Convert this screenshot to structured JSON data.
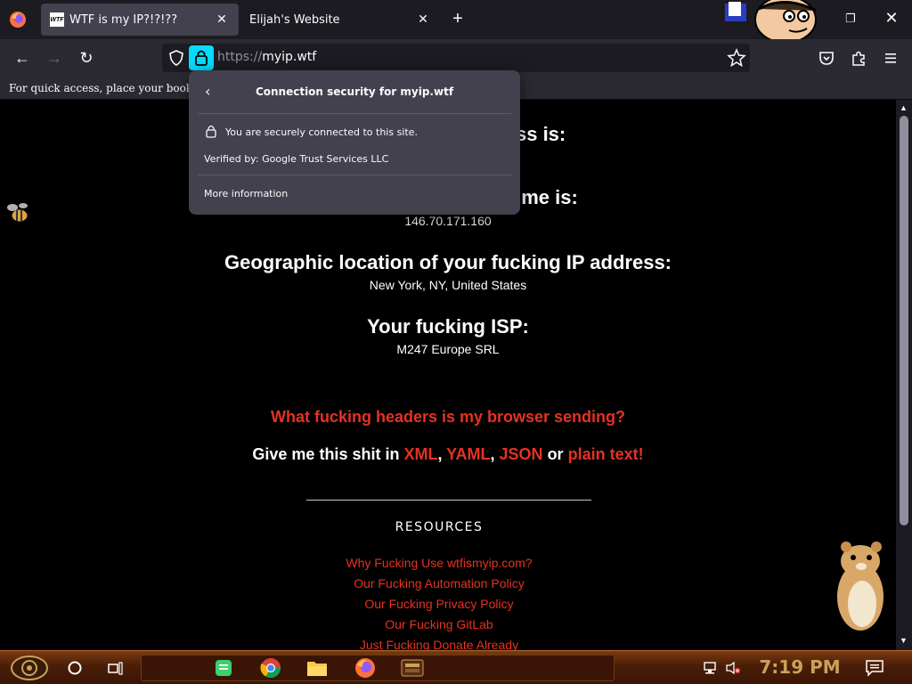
{
  "browser": {
    "tabs": [
      {
        "title": "WTF is my IP?!?!??",
        "favicon": "WTF",
        "active": true
      },
      {
        "title": "Elijah's Website",
        "active": false
      }
    ],
    "url_protocol": "https://",
    "url_host": "myip.wtf",
    "bookmarks_hint": "For quick access, place your bookmar"
  },
  "popup": {
    "title": "Connection security for myip.wtf",
    "secure_text": "You are securely connected to this site.",
    "verified_by": "Verified by: Google Trust Services LLC",
    "more_info": "More information"
  },
  "page": {
    "heading_ip_partial": "ess is:",
    "heading_hostname_partial": "me is:",
    "hostname_value": "146.70.171.160",
    "geo_heading": "Geographic location of your fucking IP address:",
    "geo_value": "New York, NY, United States",
    "isp_heading": "Your fucking ISP:",
    "isp_value": "M247 Europe SRL",
    "headers_link": "What fucking headers is my browser sending?",
    "give_me_prefix": "Give me this shit in",
    "format_xml": "XML",
    "format_yaml": "YAML",
    "format_json": "JSON",
    "or_word": "or",
    "format_plain": "plain text!",
    "resources_title": "RESOURCES",
    "resource_links": [
      "Why Fucking Use wtfismyip.com?",
      "Our Fucking Automation Policy",
      "Our Fucking Privacy Policy",
      "Our Fucking GitLab",
      "Just Fucking Donate Already"
    ]
  },
  "taskbar": {
    "clock": "7:19 PM"
  },
  "colors": {
    "accent_red": "#e53222",
    "lock_highlight": "#00ddff"
  }
}
